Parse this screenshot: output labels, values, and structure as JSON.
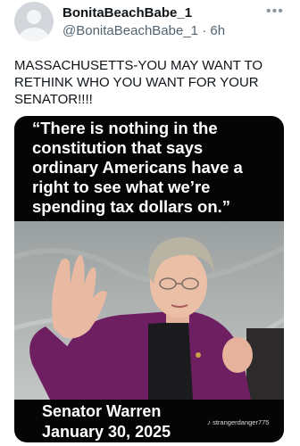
{
  "tweet": {
    "display_name": "BonitaBeachBabe_1",
    "handle": "@BonitaBeachBabe_1",
    "separator": "·",
    "time": "6h",
    "more_icon": "more-horizontal-icon",
    "text": "MASSACHUSETTS-YOU MAY WANT TO RETHINK WHO YOU WANT FOR YOUR SENATOR!!!!"
  },
  "media": {
    "quote": "“There is nothing in the constitution that says ordinary Americans have a right to see what we’re spending tax dollars on.”",
    "caption_name": "Senator Warren",
    "caption_date": "January 30, 2025",
    "watermark": "strangerdanger775",
    "watermark_icon": "tiktok-icon"
  },
  "colors": {
    "text_primary": "#0f1419",
    "text_secondary": "#536471",
    "media_background": "#050505",
    "jacket": "#6e1f62"
  }
}
